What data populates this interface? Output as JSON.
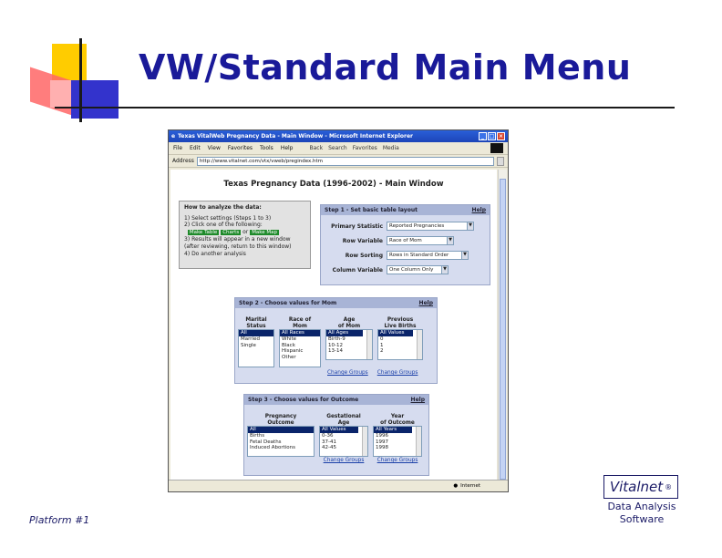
{
  "slide": {
    "title": "VW/Standard Main Menu",
    "footer_left": "Platform #1",
    "brand": "Vitalnet",
    "brand_mark": "®",
    "brand_sub_1": "Data Analysis",
    "brand_sub_2": "Software"
  },
  "browser": {
    "title": "Texas VitalWeb Pregnancy Data - Main Window - Microsoft Internet Explorer",
    "menu": [
      "File",
      "Edit",
      "View",
      "Favorites",
      "Tools",
      "Help"
    ],
    "toolbar": [
      "Back",
      "Search",
      "Favorites",
      "Media"
    ],
    "address_label": "Address",
    "address_value": "http://www.vitalnet.com/vtx/vweb/pregindex.htm",
    "status_text": "Internet"
  },
  "page": {
    "heading": "Texas Pregnancy Data (1996-2002) - Main Window",
    "howto": {
      "title": "How to analyze the data:",
      "line1": "1) Select settings (Steps 1 to 3)",
      "line2": "2) Click one of the following:",
      "btn_table": "Make Table",
      "btn_charts": "Charts",
      "or": "or",
      "btn_map": "Make Map",
      "line3": "3) Results will appear in a new window",
      "line3b": "(after reviewing, return to this window)",
      "line4": "4) Do another analysis"
    },
    "step1": {
      "title": "Step 1 - Set basic table layout",
      "help": "Help",
      "rows": [
        {
          "label": "Primary Statistic",
          "value": "Reported Pregnancies"
        },
        {
          "label": "Row Variable",
          "value": "Race of Mom"
        },
        {
          "label": "Row Sorting",
          "value": "Rows in Standard Order"
        },
        {
          "label": "Column Variable",
          "value": "One Column Only"
        }
      ]
    },
    "step2": {
      "title": "Step 2 - Choose values for Mom",
      "help": "Help",
      "columns": [
        {
          "header1": "Marital",
          "header2": "Status",
          "options": [
            "All",
            "Married",
            "Single"
          ],
          "change": ""
        },
        {
          "header1": "Race of",
          "header2": "Mom",
          "options": [
            "All Races",
            "White",
            "Black",
            "Hispanic",
            "Other"
          ],
          "change": "Change Groups"
        },
        {
          "header1": "Age",
          "header2": "of Mom",
          "options": [
            "All Ages",
            "Birth-9",
            "10-12",
            "13-14"
          ],
          "change": ""
        },
        {
          "header1": "Previous",
          "header2": "Live Births",
          "options": [
            "All Values",
            "0",
            "1",
            "2"
          ],
          "change": "Change Groups"
        }
      ]
    },
    "step3": {
      "title": "Step 3 - Choose values for Outcome",
      "help": "Help",
      "columns": [
        {
          "header1": "Pregnancy",
          "header2": "Outcome",
          "options": [
            "All",
            "Births",
            "Fetal Deaths",
            "Induced Abortions"
          ],
          "change": ""
        },
        {
          "header1": "Gestational",
          "header2": "Age",
          "options": [
            "All Values",
            "0-36",
            "37-41",
            "42-45"
          ],
          "change": "Change Groups"
        },
        {
          "header1": "Year",
          "header2": "of Outcome",
          "options": [
            "All Years",
            "1996",
            "1997",
            "1998"
          ],
          "change": "Change Groups"
        }
      ]
    }
  }
}
